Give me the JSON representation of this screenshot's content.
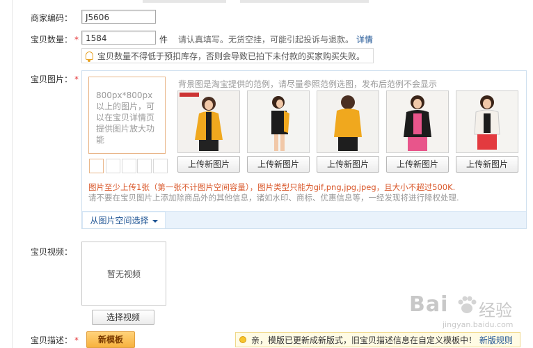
{
  "fields": {
    "merchant_code": {
      "label": "商家编码：",
      "value": "J5606"
    },
    "quantity": {
      "label": "宝贝数量：",
      "required": "*",
      "value": "1584",
      "unit": "件",
      "hint": "请认真填写。无货空挂，可能引起投诉与退款。",
      "link": "详情",
      "warning": "宝贝数量不得低于预扣库存，否则会导致已拍下未付款的买家购买失败。"
    },
    "images": {
      "label": "宝贝图片：",
      "required": "*",
      "main_hint": "800px*800px 以上的图片，可以在宝贝详情页提供图片放大功能",
      "example_note": "背景图是淘宝提供的范例，请尽量参照范例选图，发布后范例不会显示",
      "upload_buttons": [
        "上传新图片",
        "上传新图片",
        "上传新图片",
        "上传新图片",
        "上传新图片"
      ],
      "rule_red": "图片至少上传1张（第一张不计图片空间容量），图片类型只能为gif,png,jpg,jpeg，且大小不超过500K.",
      "rule_grey": "请不要在宝贝图片上添加除商品外的其他信息，诸如水印、商标、优惠信息等，一经发现将进行降权处理.",
      "select_from_space": "从图片空间选择"
    },
    "video": {
      "label": "宝贝视频：",
      "empty": "暂无视频",
      "select_button": "选择视频"
    },
    "description": {
      "label": "宝贝描述：",
      "required": "*",
      "new_template": "新模板",
      "notice": "亲，模版已更新成新版式，旧宝贝描述信息在自定义模板中！",
      "notice_link": "新版规则"
    }
  },
  "watermark": {
    "brand": "Bai",
    "brand2": "经验",
    "url": "jingyan.baidu.com"
  },
  "colors": {
    "accent_blue": "#1e5494",
    "required_red": "#e4393c",
    "rule_red": "#d9572a",
    "orange_border": "#e9b689"
  }
}
